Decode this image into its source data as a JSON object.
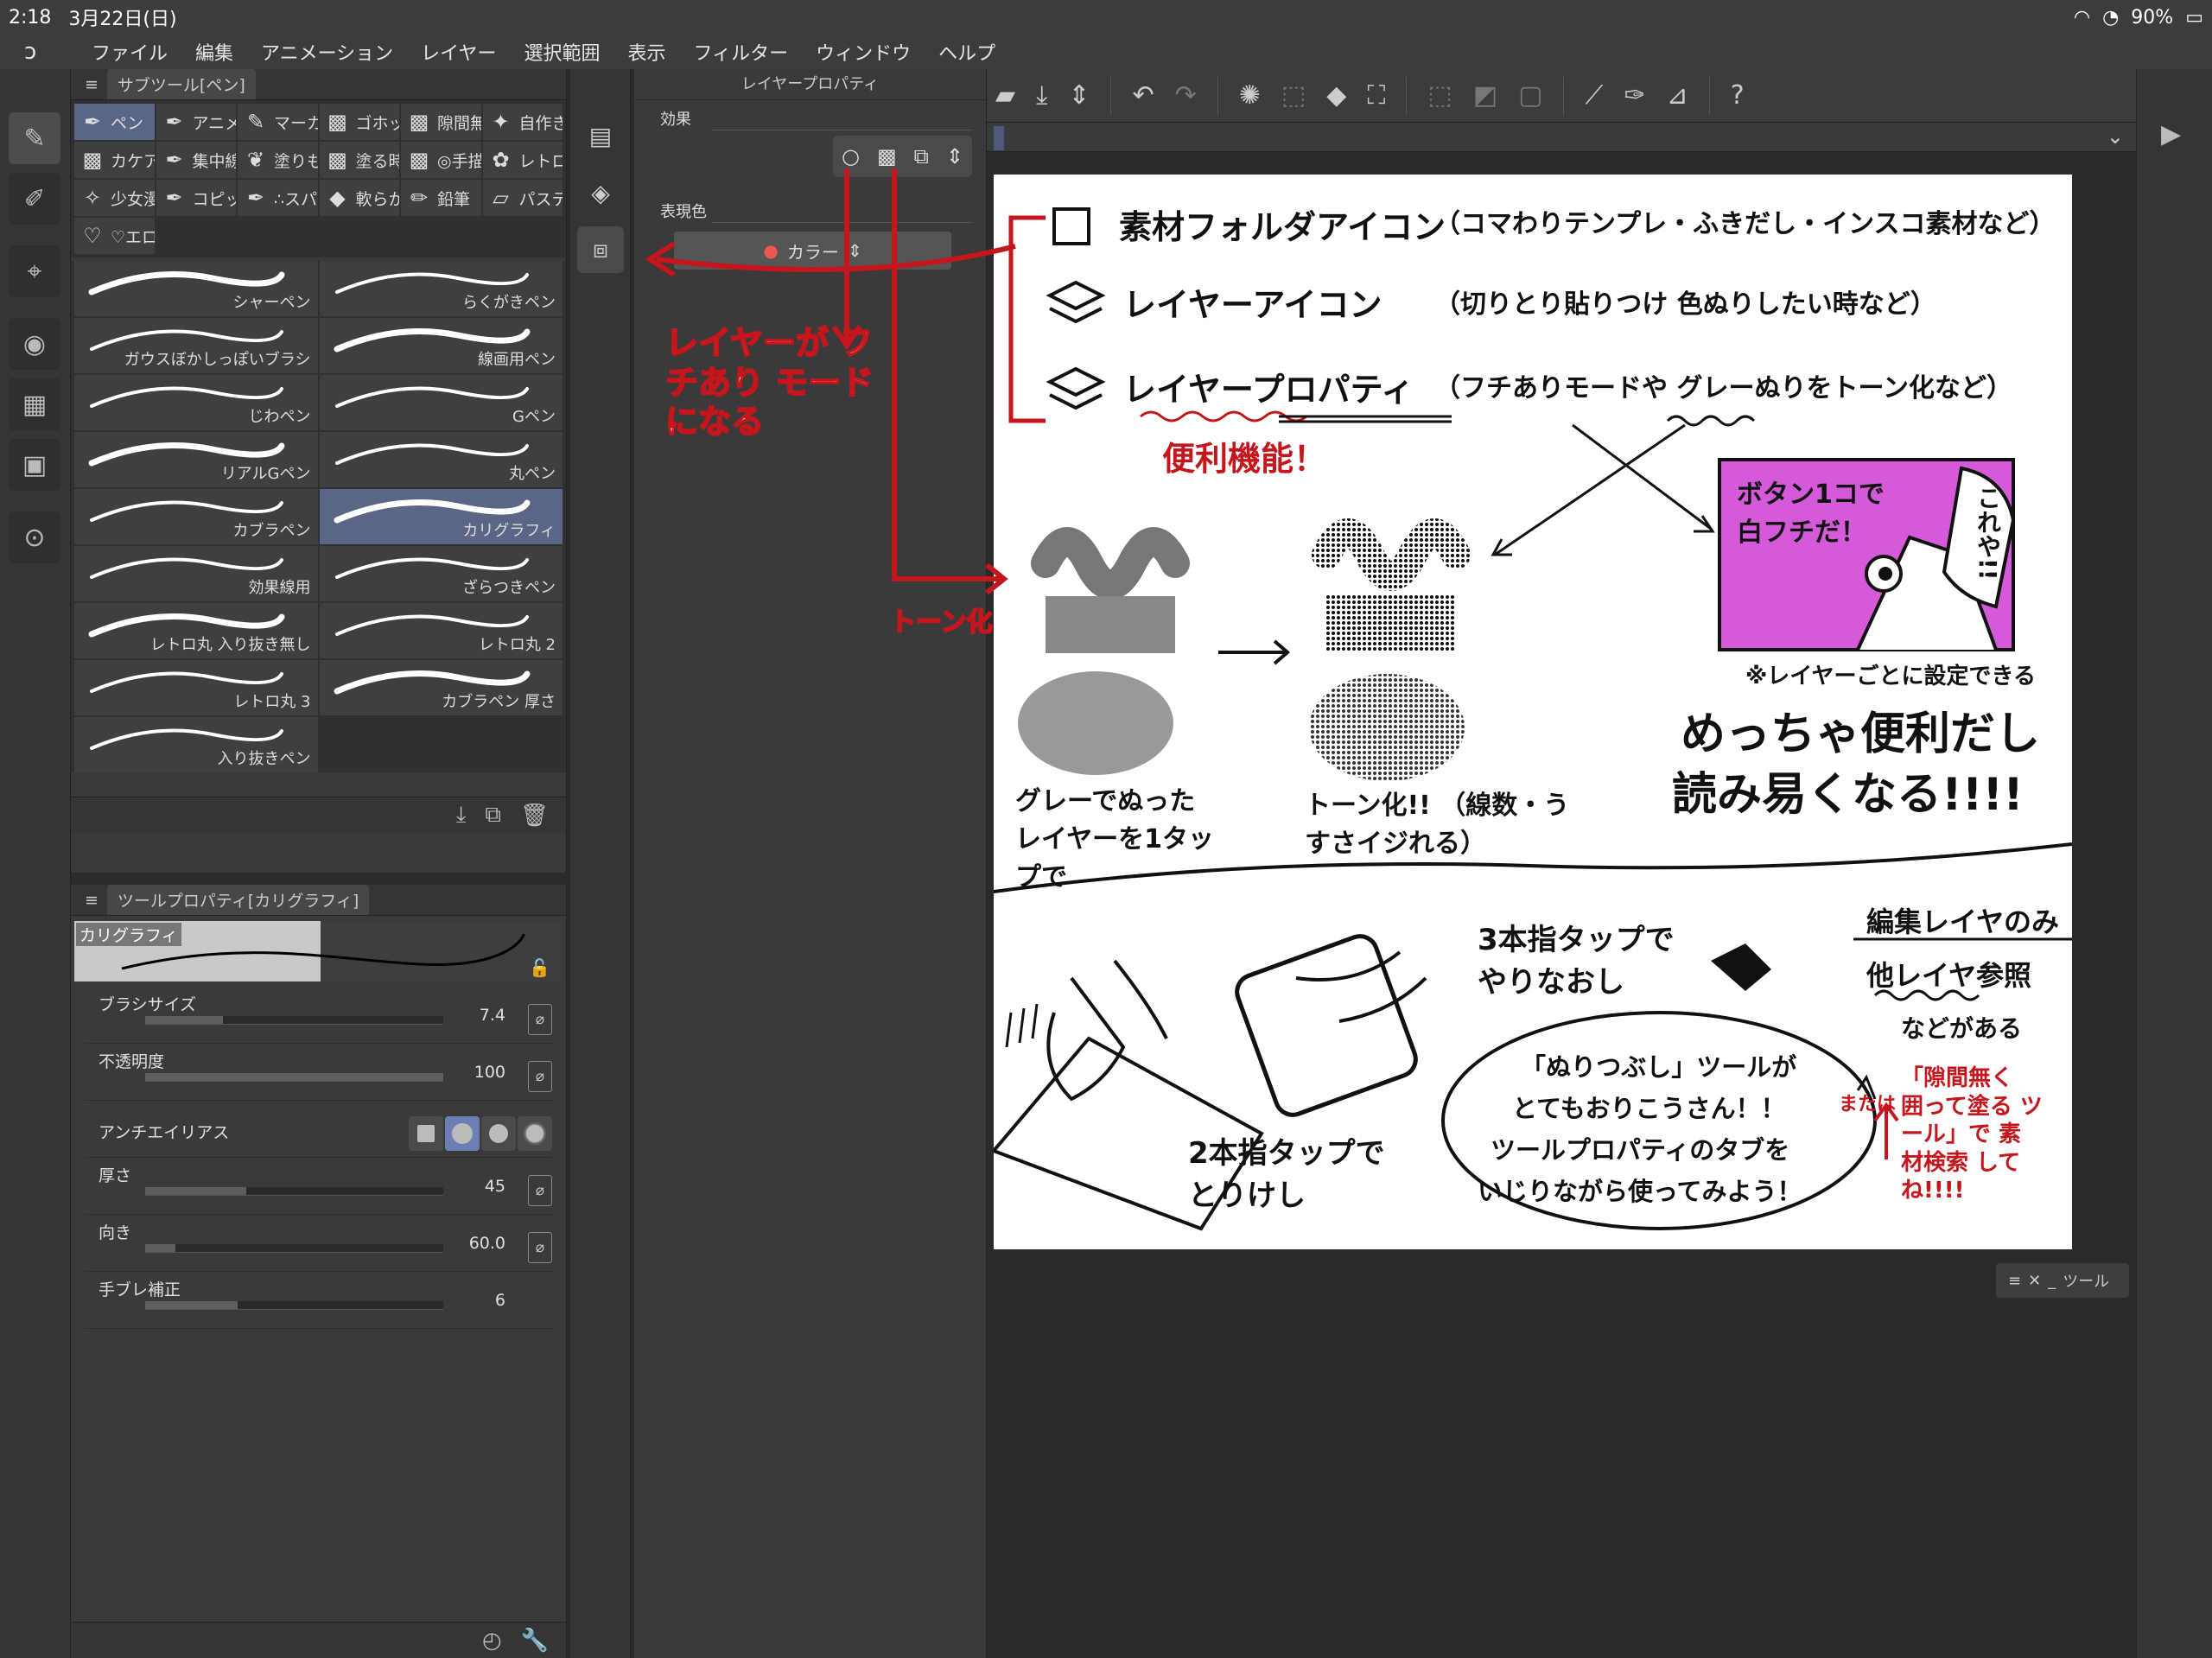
{
  "status": {
    "time": "2:18",
    "date": "3月22日(日)",
    "battery": "90%"
  },
  "menu": [
    "ファイル",
    "編集",
    "アニメーション",
    "レイヤー",
    "選択範囲",
    "表示",
    "フィルター",
    "ウィンドウ",
    "ヘルプ"
  ],
  "subtool": {
    "title": "サブツール[ペン]",
    "groups": [
      {
        "label": "ペン",
        "icon": "pen-nib-icon",
        "selected": true
      },
      {
        "label": "アニメ",
        "icon": "pen-nib-icon"
      },
      {
        "label": "マーカ",
        "icon": "marker-icon"
      },
      {
        "label": "ゴホッ",
        "icon": "material-icon"
      },
      {
        "label": "隙間無",
        "icon": "material-icon"
      },
      {
        "label": "自作き",
        "icon": "star-icon"
      },
      {
        "label": "カケア",
        "icon": "material-icon"
      },
      {
        "label": "集中線",
        "icon": "pen-nib-icon"
      },
      {
        "label": "塗りも",
        "icon": "brush-icon"
      },
      {
        "label": "塗る時",
        "icon": "material-icon"
      },
      {
        "label": "◎手描",
        "icon": "material-icon"
      },
      {
        "label": "レトロ",
        "icon": "flower-icon"
      },
      {
        "label": "少女漫",
        "icon": "sparkle-icon"
      },
      {
        "label": "コピッ",
        "icon": "pen-nib-icon"
      },
      {
        "label": "∴スパ",
        "icon": "pen-nib-icon"
      },
      {
        "label": "軟らか",
        "icon": "eraser-icon"
      },
      {
        "label": "鉛筆",
        "icon": "pencil-icon"
      },
      {
        "label": "パステ",
        "icon": "pastel-icon"
      },
      {
        "label": "♡エロ",
        "icon": "heart-icon"
      }
    ],
    "brushes": [
      "シャーペン",
      "らくがきペン",
      "ガウスぼかしっぽいブラシ",
      "線画用ペン",
      "じわペン",
      "Gペン",
      "リアルGペン",
      "丸ペン",
      "カブラペン",
      "カリグラフィ",
      "効果線用",
      "ざらつきペン",
      "レトロ丸 入り抜き無し",
      "レトロ丸 2",
      "レトロ丸 3",
      "カブラペン 厚さ",
      "入り抜きペン"
    ],
    "selected_brush": "カリグラフィ"
  },
  "toolprop": {
    "title": "ツールプロパティ[カリグラフィ]",
    "preview_label": "カリグラフィ",
    "rows": [
      {
        "label": "ブラシサイズ",
        "value": "7.4",
        "fill": 0.26
      },
      {
        "label": "不透明度",
        "value": "100",
        "fill": 1.0
      },
      {
        "label": "厚さ",
        "value": "45",
        "fill": 0.34
      },
      {
        "label": "向き",
        "value": "60.0",
        "fill": 0.1
      },
      {
        "label": "手ブレ補正",
        "value": "6",
        "fill": 0.31
      }
    ],
    "antialias_label": "アンチエイリアス"
  },
  "layerprop": {
    "title": "レイヤープロパティ",
    "effect_label": "効果",
    "color_label": "表現色",
    "color_value": "カラー"
  },
  "toolmini": "ツール",
  "annotations": {
    "outline_mode": "レイヤーが フチあり モードになる",
    "tone": "トーン化"
  },
  "paper": {
    "line1": "素材フォルダアイコン",
    "line1b": "（コマわりテンプレ・ふきだし・インスコ素材など）",
    "line2": "レイヤーアイコン",
    "line2b": "（切りとり貼りつけ 色ぬりしたい時など）",
    "line3": "レイヤープロパティ",
    "line3b": "（フチありモードや グレーぬりをトーン化など）",
    "benri": "便利機能！",
    "gray_caption": "グレーでぬった レイヤーを1タップで",
    "tone_caption": "トーン化!! （線数・うすさイジれる）",
    "button_text": "ボタン1コで 白フチだ！",
    "korega": "これや!!",
    "per_layer": "※レイヤーごとに設定できる",
    "big1": "めっちゃ便利だし",
    "big2": "読み易くなる!!!!",
    "three_finger": "3本指タップで やりなおし",
    "two_finger": "2本指タップで とりけし",
    "edit_only": "編集レイヤのみ",
    "other_ref": "他レイヤ参照",
    "nado": "などがある",
    "fill_tool1": "「ぬりつぶし」ツールが",
    "fill_tool2": "とてもおりこうさん！！",
    "fill_tool3": "ツールプロパティのタブを",
    "fill_tool4": "いじりながら使ってみよう！",
    "matawa": "または",
    "red_note": "「隙間無く 囲って塗る ツール」で 素材検索 してね!!!!"
  }
}
